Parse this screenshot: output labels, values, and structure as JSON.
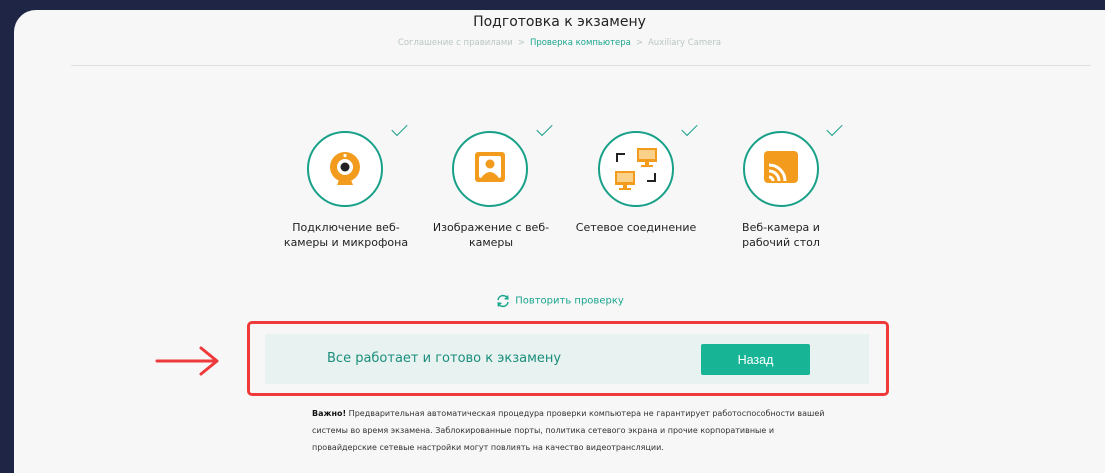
{
  "header": {
    "title": "Подготовка к экзамену",
    "breadcrumb": [
      "Соглашение с правилами",
      "Проверка компьютера",
      "Auxiliary Camera"
    ],
    "separator": ">"
  },
  "steps": [
    {
      "icon": "webcam-icon",
      "label_line1": "Подключение веб-",
      "label_line2": "камеры и микрофона",
      "checked": true
    },
    {
      "icon": "user-portrait-icon",
      "label_line1": "Изображение с веб-",
      "label_line2": "камеры",
      "checked": true
    },
    {
      "icon": "network-icon",
      "label_line1": "Сетевое соединение",
      "label_line2": "",
      "checked": true
    },
    {
      "icon": "screen-cast-icon",
      "label_line1": "Веб-камера и",
      "label_line2": "рабочий стол",
      "checked": true
    }
  ],
  "retry": {
    "label": "Повторить проверку"
  },
  "status": {
    "text": "Все работает и готово к экзамену",
    "button_label": "Назад"
  },
  "note": {
    "bold": "Важно!",
    "text": " Предварительная автоматическая процедура проверки компьютера не гарантирует работоспособности вашей системы во время экзамена. Заблокированные порты, политика сетевого экрана и прочие корпоративные и провайдерские сетевые настройки могут повлиять на качество видеотрансляции."
  },
  "colors": {
    "accent": "#18a088",
    "icon_orange": "#f29b1d",
    "highlight_red": "#ee3a3a",
    "button": "#17b596"
  }
}
